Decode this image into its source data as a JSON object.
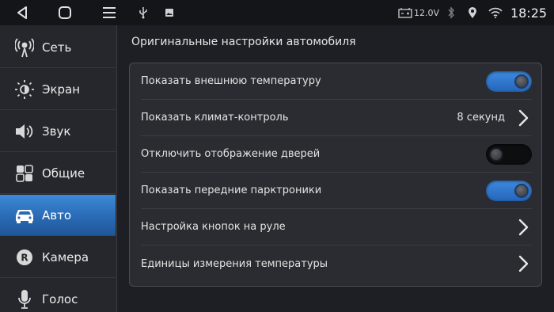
{
  "status": {
    "voltage": "12.0V",
    "time": "18:25"
  },
  "sidebar": {
    "items": [
      {
        "label": "Сеть",
        "icon": "antenna-icon",
        "active": false
      },
      {
        "label": "Экран",
        "icon": "brightness-icon",
        "active": false
      },
      {
        "label": "Звук",
        "icon": "speaker-icon",
        "active": false
      },
      {
        "label": "Общие",
        "icon": "grid-icon",
        "active": false
      },
      {
        "label": "Авто",
        "icon": "car-icon",
        "active": true
      },
      {
        "label": "Камера",
        "icon": "camera-icon",
        "active": false
      },
      {
        "label": "Голос",
        "icon": "microphone-icon",
        "active": false
      }
    ]
  },
  "main": {
    "title": "Оригинальные настройки автомобиля",
    "rows": [
      {
        "label": "Показать внешнюю температуру",
        "control": "toggle",
        "state": "on"
      },
      {
        "label": "Показать климат-контроль",
        "control": "link",
        "value": "8 секунд"
      },
      {
        "label": "Отключить отображение дверей",
        "control": "toggle",
        "state": "off"
      },
      {
        "label": "Показать передние парктроники",
        "control": "toggle",
        "state": "on"
      },
      {
        "label": "Настройка кнопок на руле",
        "control": "link"
      },
      {
        "label": "Единицы измерения температуры",
        "control": "link"
      }
    ]
  },
  "colors": {
    "accent": "#2f78c8",
    "background": "#1d1f24",
    "panel": "#2a2c31"
  }
}
